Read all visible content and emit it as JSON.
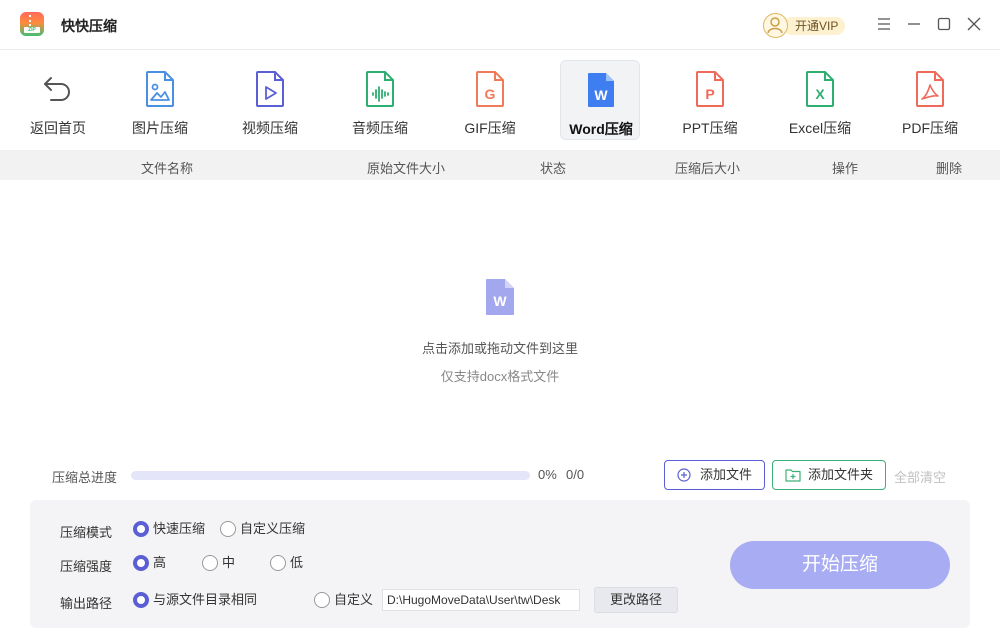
{
  "app": {
    "title": "快快压缩",
    "vip_label": "开通VIP",
    "logo_tag": "ZIP"
  },
  "toolbar": {
    "items": [
      {
        "label": "返回首页",
        "icon": "back-arrow-icon",
        "color": "#555555"
      },
      {
        "label": "图片压缩",
        "icon": "image-file-icon",
        "color": "#4a90e2"
      },
      {
        "label": "视频压缩",
        "icon": "video-file-icon",
        "color": "#5b5fd6"
      },
      {
        "label": "音频压缩",
        "icon": "audio-file-icon",
        "color": "#2eaf6f"
      },
      {
        "label": "GIF压缩",
        "icon": "gif-file-icon",
        "color": "#f07a5a",
        "glyph": "G"
      },
      {
        "label": "Word压缩",
        "icon": "word-file-icon",
        "color": "#3f7ef0",
        "glyph": "W",
        "active": true
      },
      {
        "label": "PPT压缩",
        "icon": "ppt-file-icon",
        "color": "#f06a5a",
        "glyph": "P"
      },
      {
        "label": "Excel压缩",
        "icon": "excel-file-icon",
        "color": "#2eaf6f",
        "glyph": "X"
      },
      {
        "label": "PDF压缩",
        "icon": "pdf-file-icon",
        "color": "#f06a5a"
      }
    ]
  },
  "table": {
    "columns": [
      "文件名称",
      "原始文件大小",
      "状态",
      "压缩后大小",
      "操作",
      "删除"
    ]
  },
  "dropzone": {
    "glyph": "W",
    "main_text": "点击添加或拖动文件到这里",
    "sub_text": "仅支持docx格式文件"
  },
  "progress": {
    "label": "压缩总进度",
    "percent_text": "0%",
    "count_text": "0/0",
    "fraction": 0
  },
  "actions": {
    "add_file": "添加文件",
    "add_folder": "添加文件夹",
    "clear_all": "全部清空"
  },
  "settings": {
    "mode_label": "压缩模式",
    "mode_options": [
      "快速压缩",
      "自定义压缩"
    ],
    "mode_selected": "快速压缩",
    "strength_label": "压缩强度",
    "strength_options": [
      "高",
      "中",
      "低"
    ],
    "strength_selected": "高",
    "output_label": "输出路径",
    "output_options": [
      "与源文件目录相同",
      "自定义"
    ],
    "output_selected": "与源文件目录相同",
    "path_value": "D:\\HugoMoveData\\User\\tw\\Desk",
    "change_path": "更改路径",
    "start_button": "开始压缩"
  },
  "colors": {
    "accent": "#5b5fd6",
    "start_button": "#a8acf2",
    "progress_track": "#e4e5f8"
  }
}
